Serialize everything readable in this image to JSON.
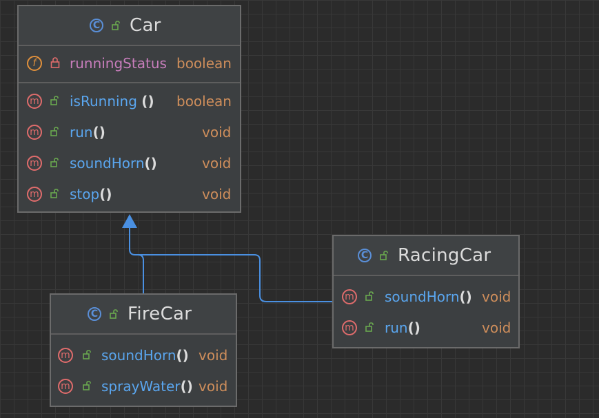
{
  "colors": {
    "background": "#2b2b2b",
    "node_bg": "#3c3f41",
    "method_badge": "#e06c6c",
    "field_badge": "#e0903c",
    "class_badge": "#5a8fd8",
    "name_blue": "#5aa6ef",
    "field_name": "#c77dbb",
    "type_orange": "#cf8e5b",
    "edge": "#4a90e2",
    "public_lock": "#6aa84f",
    "private_lock": "#e06c6c"
  },
  "classes": {
    "car": {
      "name": "Car",
      "badge": "C",
      "fields": [
        {
          "name": "runningStatus",
          "type": "boolean",
          "badge": "f",
          "visibility": "private"
        }
      ],
      "methods": [
        {
          "name": "isRunning",
          "parens": "()",
          "type": "boolean",
          "badge": "m"
        },
        {
          "name": "run",
          "parens": "()",
          "type": "void",
          "badge": "m"
        },
        {
          "name": "soundHorn",
          "parens": "()",
          "type": "void",
          "badge": "m"
        },
        {
          "name": "stop",
          "parens": "()",
          "type": "void",
          "badge": "m"
        }
      ]
    },
    "racingcar": {
      "name": "RacingCar",
      "badge": "C",
      "methods": [
        {
          "name": "soundHorn",
          "parens": "()",
          "type": "void",
          "badge": "m"
        },
        {
          "name": "run",
          "parens": "()",
          "type": "void",
          "badge": "m"
        }
      ]
    },
    "firecar": {
      "name": "FireCar",
      "badge": "C",
      "methods": [
        {
          "name": "soundHorn",
          "parens": "()",
          "type": "void",
          "badge": "m"
        },
        {
          "name": "sprayWater",
          "parens": "()",
          "type": "void",
          "badge": "m"
        }
      ]
    }
  },
  "relations": [
    {
      "from": "FireCar",
      "to": "Car",
      "type": "extends"
    },
    {
      "from": "RacingCar",
      "to": "Car",
      "type": "extends"
    }
  ]
}
